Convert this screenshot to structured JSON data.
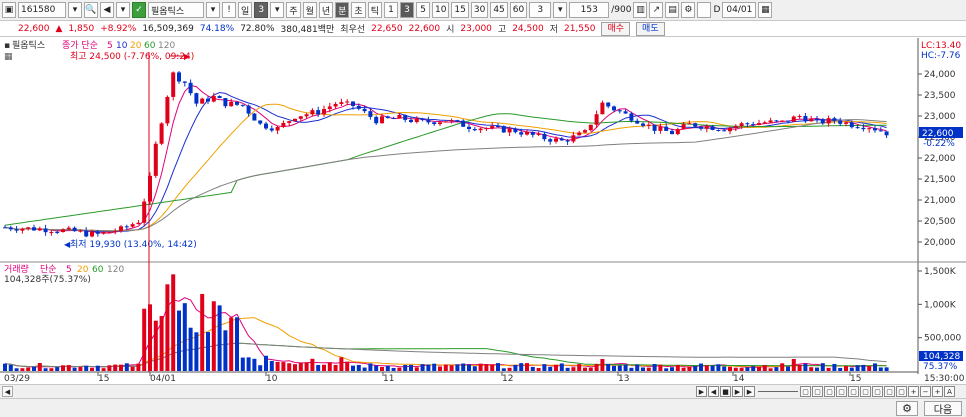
{
  "toolbar": {
    "code": "161580",
    "name": "필옵틱스",
    "periods": [
      "일",
      "3",
      "주",
      "월",
      "년",
      "분",
      "초",
      "틱",
      "1",
      "3",
      "5",
      "10",
      "15",
      "30",
      "45",
      "60"
    ],
    "interval": "3",
    "count": "153",
    "count_total": "/900",
    "date_check_label": "D",
    "date": "04/01",
    "bang": "!"
  },
  "quote": {
    "price": "22,600",
    "change": "1,850",
    "change_pct": "+8.92%",
    "volume": "16,509,369",
    "ratio1": "74.18%",
    "ratio2": "72.80%",
    "amount": "380,481백만",
    "best_label": "최우선",
    "best_ask": "22,650",
    "best_bid": "22,600",
    "open_label": "시",
    "open": "23,000",
    "high_label": "고",
    "high": "24,500",
    "low_label": "저",
    "low": "21,550",
    "buy_label": "매수",
    "sell_label": "매도"
  },
  "price_panel": {
    "title": "필옵틱스",
    "legend_prefix": "종가 단순",
    "ma_periods": [
      "5",
      "10",
      "20",
      "60",
      "120"
    ],
    "ma_colors": [
      "#e0007a",
      "#1c2fd0",
      "#f0a000",
      "#2a9a2a",
      "#808080"
    ],
    "high_note": "최고 24,500 (-7.76%, 09:24)",
    "low_note": "최저 19,930 (13.40%, 14:42)",
    "lc_label": "LC:13.40",
    "hc_label": "HC:-7.76",
    "y_ticks": [
      "24,000",
      "23,500",
      "23,000",
      "22,500",
      "22,000",
      "21,500",
      "21,000",
      "20,500",
      "20,000"
    ],
    "y_values": [
      24000,
      23500,
      23000,
      22500,
      22000,
      21500,
      21000,
      20500,
      20000
    ],
    "current_price": "22,600",
    "current_pct": "-0.22%"
  },
  "volume_panel": {
    "title": "거래량",
    "legend_prefix": "단순",
    "ma_periods": [
      "5",
      "20",
      "60",
      "120"
    ],
    "ma_colors": [
      "#e0007a",
      "#f0a000",
      "#2a9a2a",
      "#808080"
    ],
    "value_note": "104,328주(75.37%)",
    "y_ticks": [
      "1,500K",
      "1,000K",
      "500,000"
    ],
    "y_values": [
      1500000,
      1000000,
      500000
    ],
    "current_volume": "104,328",
    "current_pct": "75.37%"
  },
  "x_axis": {
    "labels": [
      "03/29",
      "15",
      "04/01",
      "10",
      "11",
      "12",
      "13",
      "14",
      "15"
    ],
    "time_label": "15:30:00"
  },
  "bottom": {
    "next_label": "다음"
  },
  "colors": {
    "up": "#e0001a",
    "down": "#0032c8",
    "axis": "#555555"
  }
}
